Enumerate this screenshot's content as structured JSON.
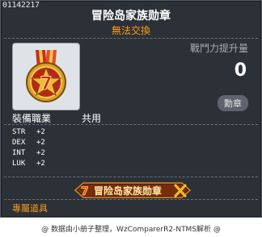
{
  "tooltip": {
    "item_id": "01142217",
    "title": "冒险岛家族勋章",
    "trade_status": "無法交換",
    "combat_power_label": "戰鬥力提升量",
    "combat_power_value": "0",
    "item_type": "勳章",
    "job_label": "裝備職業",
    "job_value": "共用",
    "stats": [
      {
        "name": "STR",
        "value": "+2"
      },
      {
        "name": "DEX",
        "value": "+2"
      },
      {
        "name": "INT",
        "value": "+2"
      },
      {
        "name": "LUK",
        "value": "+2"
      }
    ],
    "medal_banner_text": "冒险岛家族勋章",
    "exclusive_label": "專屬道具"
  },
  "footer": {
    "text": "@ 数据由小册子整理，WzComparerR2-NTMS解析 @"
  },
  "colors": {
    "background": "#2c3138",
    "accent_orange": "#ff9a1a",
    "text_white": "#ffffff",
    "muted": "#a6adb6"
  }
}
